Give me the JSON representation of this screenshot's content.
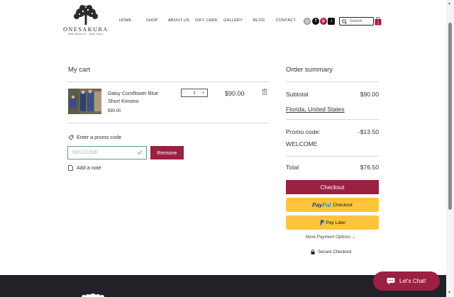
{
  "brand": {
    "name": "ONESAKURA",
    "tagline": "ONE BEAUTY · ONE SOUL"
  },
  "nav": [
    "HOME",
    "SHOP",
    "ABOUT US",
    "GIFT CARD",
    "GALLERY",
    "BLOG",
    "CONTACT"
  ],
  "social": [
    "instagram-icon",
    "facebook-icon",
    "pinterest-icon",
    "tiktok-icon"
  ],
  "search": {
    "placeholder": "Search"
  },
  "cart_badge": "1",
  "cart": {
    "title": "My cart",
    "item": {
      "name": "Daisy Cornflower Blue Short Kimono",
      "unit_price": "$90.00",
      "quantity": "1",
      "total": "$90.00"
    },
    "promo_link": "Enter a promo code",
    "promo_value": "WELCOME",
    "remove_label": "Remove",
    "note_link": "Add a note"
  },
  "summary": {
    "title": "Order summary",
    "subtotal_label": "Subtotal",
    "subtotal_value": "$90.00",
    "location": "Florida, United States",
    "promo_label": "Promo code:",
    "promo_code": "WELCOME",
    "promo_value": "-$13.50",
    "total_label": "Total",
    "total_value": "$76.50",
    "checkout_label": "Checkout",
    "paypal_part1": "Pay",
    "paypal_part2": "Pal",
    "paypal_checkout": "Checkout",
    "paylater_label": "Pay Later",
    "more_payment": "More Payment Options",
    "secure": "Secure Checkout"
  },
  "chat": {
    "label": "Let's Chat!"
  },
  "colors": {
    "accent": "#9b2042",
    "paypal_yellow": "#ffc43a",
    "footer": "#222128",
    "promo_border": "#5c9c7d"
  }
}
